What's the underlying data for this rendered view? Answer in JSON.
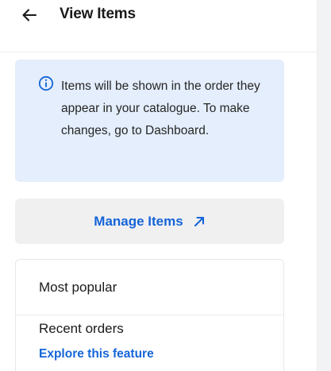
{
  "header": {
    "title": "View Items",
    "back_icon": "arrow-left-icon"
  },
  "info": {
    "icon": "info-circle-icon",
    "text": "Items will be shown in the order they appear in your catalogue. To make changes, go to Dashboard."
  },
  "manage": {
    "label": "Manage Items",
    "icon": "arrow-up-right-icon"
  },
  "list": {
    "items": [
      {
        "title": "Most popular"
      },
      {
        "title": "Recent orders",
        "link": "Explore this feature"
      }
    ]
  },
  "colors": {
    "accent": "#1565d8",
    "info_background": "#e4eefc",
    "button_background": "#f0f0f1"
  }
}
